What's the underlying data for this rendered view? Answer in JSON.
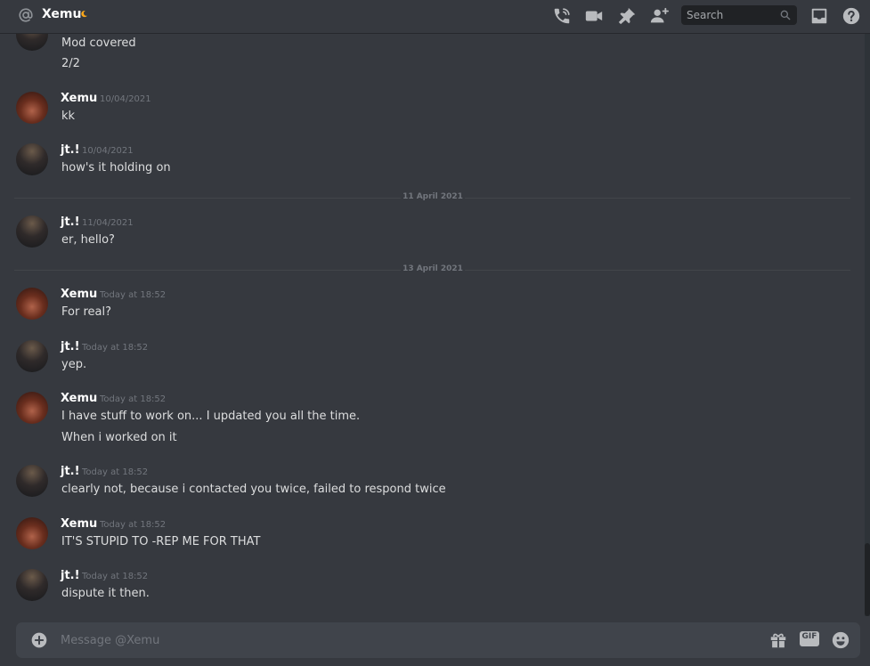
{
  "header": {
    "dm_name": "Xemu",
    "search_placeholder": "Search"
  },
  "messages": [
    {
      "user": "",
      "timestamp": "",
      "lines": [
        "Mod covered",
        "2/2"
      ]
    },
    {
      "user": "Xemu",
      "timestamp": "10/04/2021",
      "lines": [
        "kk"
      ]
    },
    {
      "user": "jt.!",
      "timestamp": "10/04/2021",
      "lines": [
        "how's it holding on"
      ]
    },
    {
      "user": "jt.!",
      "timestamp": "11/04/2021",
      "lines": [
        "er, hello?"
      ]
    },
    {
      "user": "Xemu",
      "timestamp": "Today at 18:52",
      "lines": [
        "For real?"
      ]
    },
    {
      "user": "jt.!",
      "timestamp": "Today at 18:52",
      "lines": [
        "yep."
      ]
    },
    {
      "user": "Xemu",
      "timestamp": "Today at 18:52",
      "lines": [
        "I have stuff to work on... I updated you all the time.",
        "When i worked on it"
      ]
    },
    {
      "user": "jt.!",
      "timestamp": "Today at 18:52",
      "lines": [
        "clearly not, because i contacted you twice, failed to respond twice"
      ]
    },
    {
      "user": "Xemu",
      "timestamp": "Today at 18:52",
      "lines": [
        "IT'S STUPID TO -REP ME FOR THAT"
      ]
    },
    {
      "user": "jt.!",
      "timestamp": "Today at 18:52",
      "lines": [
        "dispute it then."
      ]
    }
  ],
  "dividers": [
    "11 April 2021",
    "13 April 2021"
  ],
  "composer": {
    "placeholder": "Message @Xemu",
    "gif_label": "GIF"
  },
  "icons": {
    "header": [
      "at-icon",
      "moon-status-icon",
      "voice-call-icon",
      "video-call-icon",
      "pinned-messages-icon",
      "add-friend-icon",
      "search-icon",
      "inbox-icon",
      "help-icon"
    ],
    "composer": [
      "attach-plus-icon",
      "gift-icon",
      "gif-icon",
      "emoji-icon"
    ]
  },
  "colors": {
    "background": "#36393f",
    "composer": "#40444b",
    "username": "#ffffff",
    "timestamp": "#72767d",
    "text": "#dcddde",
    "status_moon": "#faa61a"
  }
}
